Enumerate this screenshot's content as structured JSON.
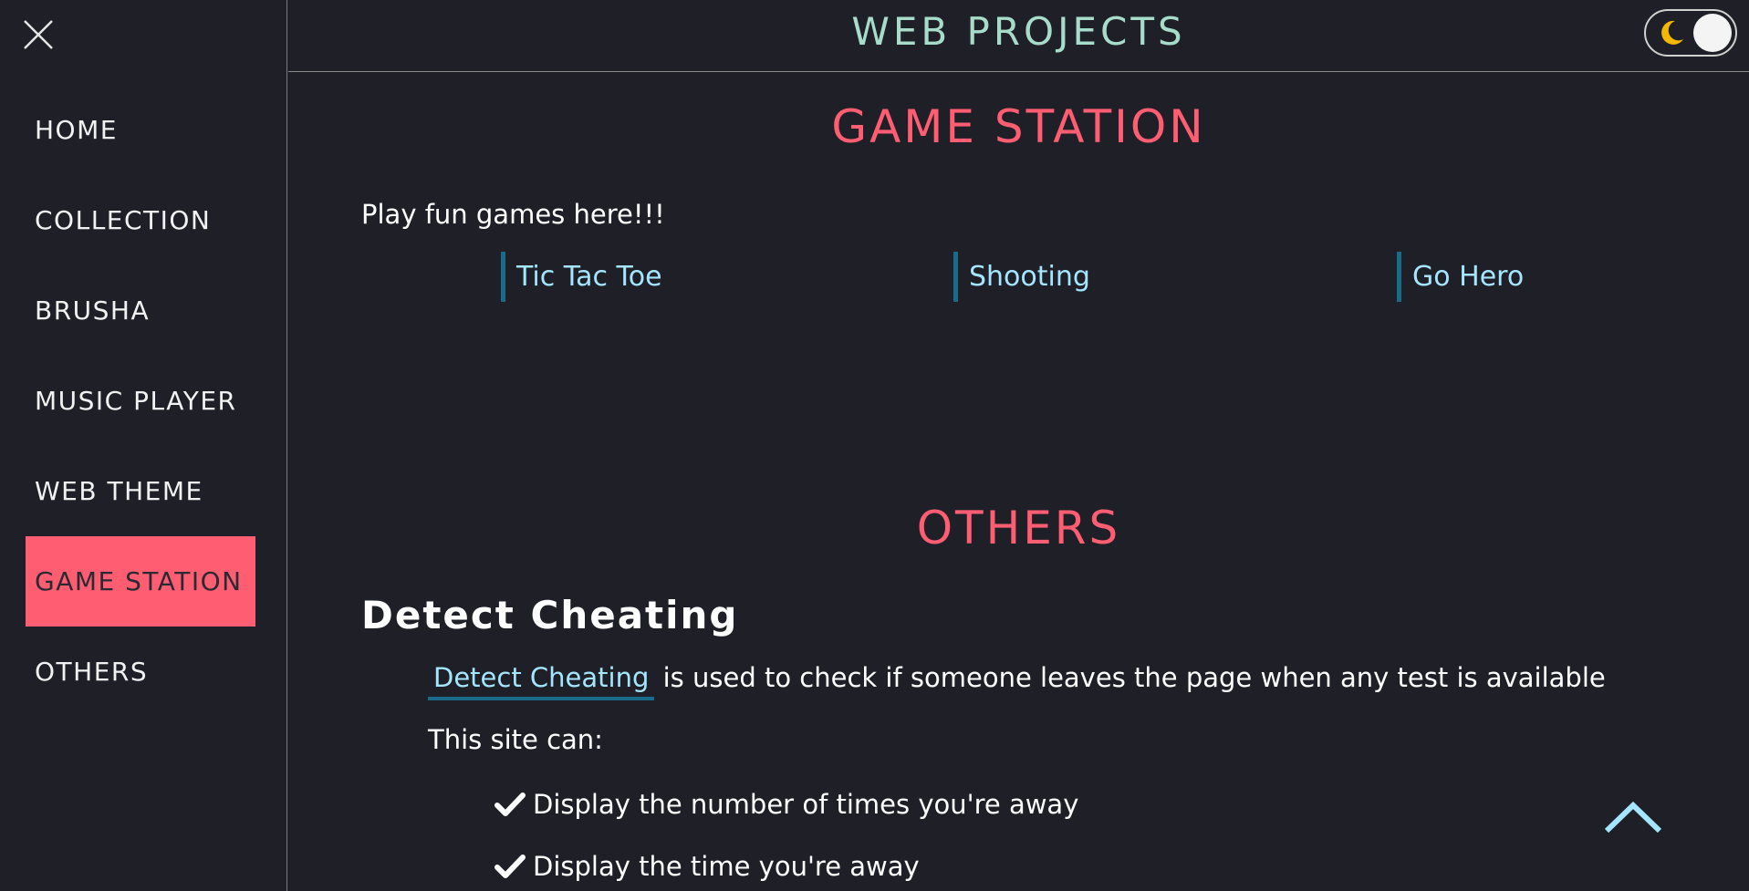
{
  "header": {
    "title": "WEB PROJECTS",
    "theme_toggle_icon": "moon-icon",
    "theme_mode": "dark"
  },
  "sidebar": {
    "close_icon": "close-icon",
    "items": [
      {
        "label": "HOME",
        "active": false
      },
      {
        "label": "COLLECTION",
        "active": false
      },
      {
        "label": "BRUSHA",
        "active": false
      },
      {
        "label": "MUSIC PLAYER",
        "active": false
      },
      {
        "label": "WEB THEME",
        "active": false
      },
      {
        "label": "GAME STATION",
        "active": true
      },
      {
        "label": "OTHERS",
        "active": false
      }
    ]
  },
  "game_station": {
    "title": "GAME STATION",
    "intro": "Play fun games here!!!",
    "games": [
      "Tic Tac Toe",
      "Shooting",
      "Go Hero"
    ]
  },
  "others": {
    "title": "OTHERS",
    "detect_cheating": {
      "heading": "Detect Cheating",
      "link_text": "Detect Cheating",
      "description": "is used to check if someone leaves the page when any test is available",
      "can_label": "This site can:",
      "features": [
        "Display the number of times you're away",
        "Display the time you're away"
      ]
    }
  },
  "scroll_top_icon": "chevron-up-icon",
  "colors": {
    "background": "#1f2027",
    "accent": "#ff5d72",
    "title": "#a7dcca",
    "link": "#a4e6ff",
    "link_border": "#1a6a8a",
    "moon": "#f5b800"
  }
}
